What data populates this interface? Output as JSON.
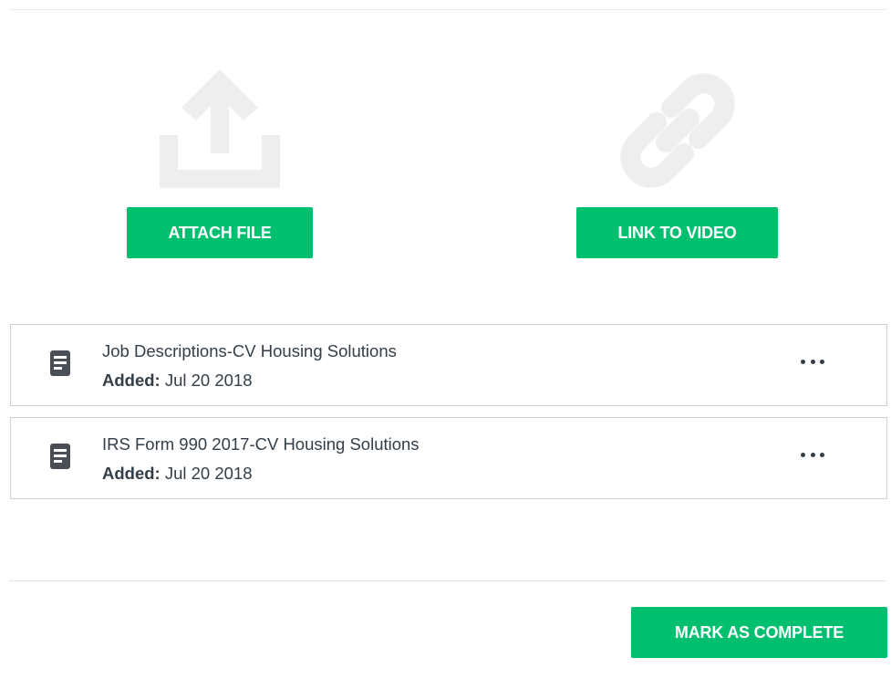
{
  "upload": {
    "icon": "upload-icon",
    "button_label": "ATTACH FILE"
  },
  "video": {
    "icon": "link-icon",
    "button_label": "LINK TO VIDEO"
  },
  "files": [
    {
      "icon": "document-icon",
      "name": "Job Descriptions-CV Housing Solutions",
      "added_label": "Added:",
      "added_date": "Jul 20 2018",
      "menu_icon": "more-options-icon"
    },
    {
      "icon": "document-icon",
      "name": "IRS Form 990 2017-CV Housing Solutions",
      "added_label": "Added:",
      "added_date": "Jul 20 2018",
      "menu_icon": "more-options-icon"
    }
  ],
  "footer": {
    "complete_label": "MARK AS COMPLETE"
  },
  "colors": {
    "accent": "#00bf6f",
    "icon_placeholder": "#eeeeee",
    "text": "#333e48",
    "border": "#d0d0d0"
  }
}
